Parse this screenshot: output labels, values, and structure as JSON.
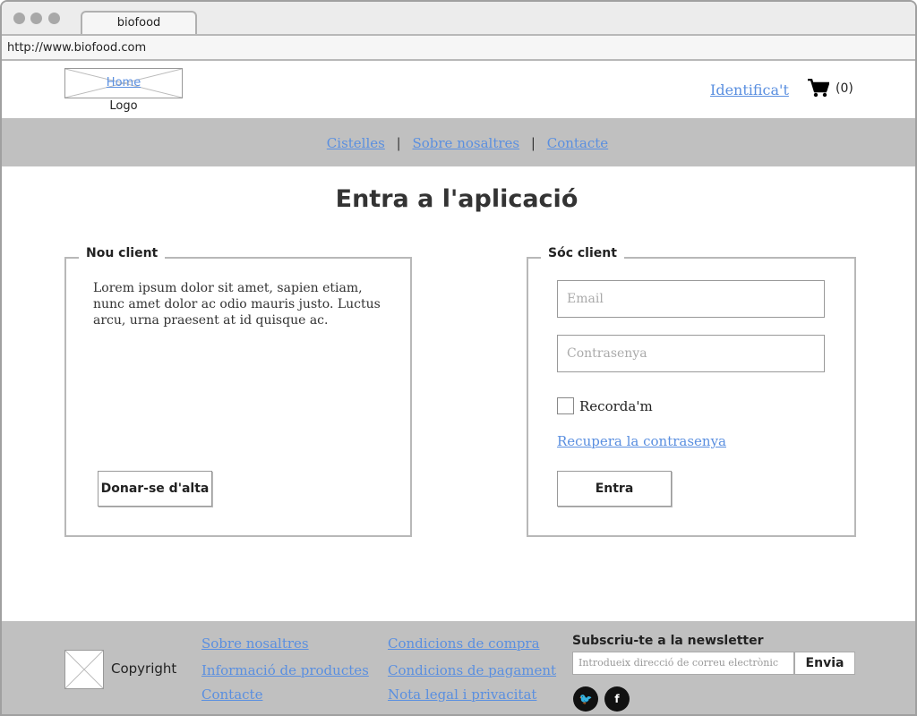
{
  "browser": {
    "tab_title": "biofood",
    "url": "http://www.biofood.com"
  },
  "header": {
    "home_link": "Home",
    "logo_label": "Logo",
    "identify_link": "Identifica't",
    "cart_count": "(0)"
  },
  "nav": {
    "items": [
      "Cistelles",
      "Sobre nosaltres",
      "Contacte"
    ],
    "separator": "|"
  },
  "page_title": "Entra a l'aplicació",
  "new_client": {
    "legend": "Nou client",
    "text": "Lorem ipsum dolor sit amet, sapien etiam, nunc amet dolor ac odio mauris justo. Luctus arcu, urna praesent at id quisque ac.",
    "signup_button": "Donar-se d'alta"
  },
  "existing_client": {
    "legend": "Sóc client",
    "email_placeholder": "Email",
    "password_placeholder": "Contrasenya",
    "remember_label": "Recorda'm",
    "remember_checked": false,
    "recover_link": "Recupera la contrasenya",
    "login_button": "Entra"
  },
  "footer": {
    "copyright": "Copyright",
    "col1": [
      "Sobre nosaltres",
      "Informació de productes",
      "Contacte"
    ],
    "col2": [
      "Condicions de compra",
      "Condicions de pagament",
      "Nota legal i privacitat"
    ],
    "newsletter_title": "Subscriu-te a la newsletter",
    "newsletter_placeholder": "Introdueix direcció de correu electrònic",
    "newsletter_button": "Envia",
    "social_icons": [
      "twitter-icon",
      "facebook-icon"
    ],
    "social_glyphs": {
      "twitter": "🐦",
      "facebook": "f"
    }
  },
  "colors": {
    "link": "#5a8fe0",
    "band": "#c0c0c0",
    "border": "#b8b8b8"
  }
}
